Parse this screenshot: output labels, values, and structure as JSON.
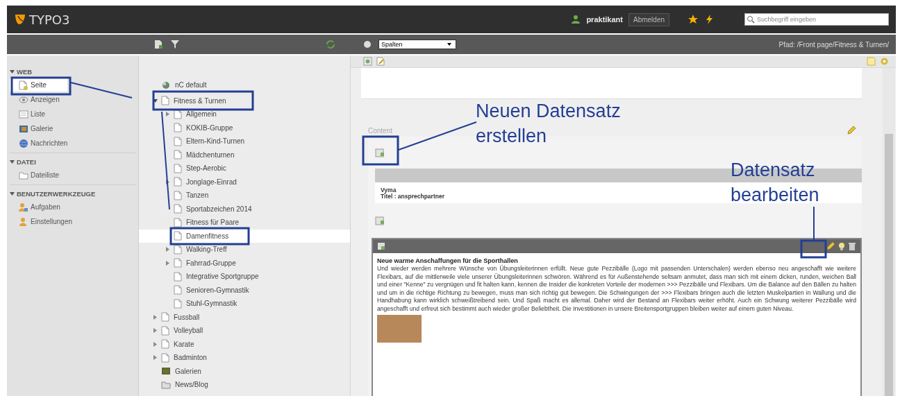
{
  "topbar": {
    "logo": "TYPO3",
    "user": "praktikant",
    "logout": "Abmelden",
    "search": {
      "placeholder": "Suchbegriff eingeben"
    }
  },
  "module_menu": [
    {
      "label": "WEB",
      "expanded": true,
      "items": [
        {
          "label": "Seite",
          "selected": true
        },
        {
          "label": "Anzeigen",
          "selected": false
        },
        {
          "label": "Liste",
          "selected": false
        },
        {
          "label": "Galerie",
          "selected": false
        },
        {
          "label": "Nachrichten",
          "selected": false
        }
      ]
    },
    {
      "label": "DATEI",
      "expanded": true,
      "items": [
        {
          "label": "Dateiliste",
          "selected": false
        }
      ]
    },
    {
      "label": "BENUTZERWERKZEUGE",
      "expanded": true,
      "items": [
        {
          "label": "Aufgaben",
          "selected": false
        },
        {
          "label": "Einstellungen",
          "selected": false
        }
      ]
    }
  ],
  "page_tree": [
    {
      "label": "nC default",
      "kind": "root",
      "selected": false
    },
    {
      "label": "Fitness & Turnen",
      "kind": "page",
      "selected": false,
      "expanded": true,
      "children": [
        {
          "label": "Allgemein",
          "kind": "page",
          "selected": false,
          "expanded": false
        },
        {
          "label": "KOKIB-Gruppe",
          "kind": "page",
          "selected": false
        },
        {
          "label": "Eltern-Kind-Turnen",
          "kind": "page",
          "selected": false
        },
        {
          "label": "Mädchenturnen",
          "kind": "page",
          "selected": false
        },
        {
          "label": "Step-Aerobic",
          "kind": "page",
          "selected": false
        },
        {
          "label": "Jonglage-Einrad",
          "kind": "page",
          "selected": false,
          "expanded": false
        },
        {
          "label": "Tanzen",
          "kind": "page",
          "selected": false
        },
        {
          "label": "Sportabzeichen 2014",
          "kind": "page",
          "selected": false
        },
        {
          "label": "Fitness für Paare",
          "kind": "page",
          "selected": false
        },
        {
          "label": "Damenfitness",
          "kind": "page",
          "selected": true
        },
        {
          "label": "Walking-Treff",
          "kind": "page",
          "selected": false,
          "expanded": false
        },
        {
          "label": "Fahrrad-Gruppe",
          "kind": "page",
          "selected": false,
          "expanded": false
        },
        {
          "label": "Integrative Sportgruppe",
          "kind": "page",
          "selected": false
        },
        {
          "label": "Senioren-Gymnastik",
          "kind": "page",
          "selected": false
        },
        {
          "label": "Stuhl-Gymnastik",
          "kind": "page",
          "selected": false
        }
      ]
    },
    {
      "label": "Fussball",
      "kind": "page",
      "selected": false,
      "expanded": false
    },
    {
      "label": "Volleyball",
      "kind": "page",
      "selected": false,
      "expanded": false
    },
    {
      "label": "Karate",
      "kind": "page",
      "selected": false,
      "expanded": false
    },
    {
      "label": "Badminton",
      "kind": "page",
      "selected": false,
      "expanded": false
    },
    {
      "label": "Galerien",
      "kind": "gallery",
      "selected": false
    },
    {
      "label": "News/Blog",
      "kind": "folder",
      "selected": false
    }
  ],
  "content": {
    "view_select": "Spalten",
    "path": "Pfad: /Front page/Fitness & Turnen/",
    "column_label": "Content",
    "record": {
      "title": "Vyma",
      "subtitle": "Titel : ansprechpartner"
    },
    "element": {
      "heading": "Neue warme Anschaffungen für die Sporthallen",
      "text": "Und wieder werden mehrere Wünsche von Übungsleiterinnen erfüllt. Neue gute Pezzibälle (Logo mit passenden Unterschalen) werden ebenso neu angeschafft wie weitere Flexibars, auf die mittlerweile viele unserer Übungsleiterinnen schwören. Während es für Außenstehende seltsam anmutet, dass man sich mit einem dicken, runden, weichen Ball und einer \"Kenne\" zu vergnügen und fit halten kann, kennen die Insider die konkreten Vorteile der modernen >>> Pezzibälle und Flexibars. Um die Balance auf den Bällen zu halten und um in die richtige Richtung zu bewegen, muss man sich richtig gut bewegen. Die Schwingungen der >>> Flexibars bringen auch die letzten Muskelpartien in Wallung und die Handhabung kann wirklich schweißtreibend sein. Und Spaß macht es allemal. Daher wird der Bestand an Flexibars weiter erhöht. Auch ein Schwung weiterer Pezzibälle wird angeschafft und erfreut sich bestimmt auch wieder großer Beliebtheit. Die Investitionen in unsere Breitensportgruppen bleiben weiter auf einem guten Niveau."
    }
  },
  "annotations": [
    {
      "text": "Neuen Datensatz erstellen"
    },
    {
      "text": "Datensatz bearbeiten"
    }
  ]
}
